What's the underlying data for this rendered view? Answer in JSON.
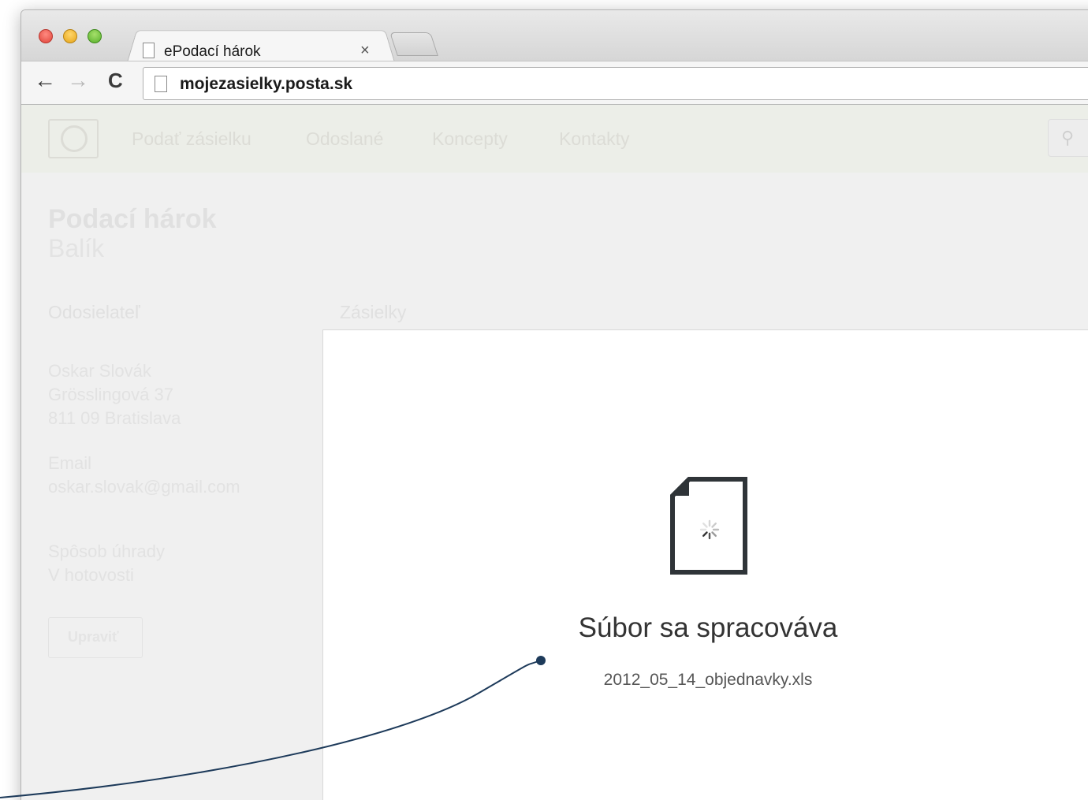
{
  "browser": {
    "tab_title": "ePodací hárok",
    "tab_close": "×",
    "url": "mojezasielky.posta.sk"
  },
  "site": {
    "nav": [
      "Podať zásielku",
      "Odoslané",
      "Koncepty",
      "Kontakty"
    ],
    "page_title": "Podací hárok",
    "page_subtitle": "Balík",
    "sections": {
      "sender": "Odosielateľ",
      "shipments": "Zásielky"
    },
    "sender": {
      "name": "Oskar Slovák",
      "street": "Grösslingová 37",
      "city": "811 09 Bratislava",
      "email_label": "Email",
      "email": "oskar.slovak@gmail.com",
      "payment_label": "Spôsob úhrady",
      "payment_value": "V hotovosti"
    },
    "update_button": "Upraviť"
  },
  "processing": {
    "title": "Súbor sa spracováva",
    "filename": "2012_05_14_objednavky.xls"
  },
  "colors": {
    "callout": "#1d3a5a",
    "file_icon": "#2f3438"
  }
}
